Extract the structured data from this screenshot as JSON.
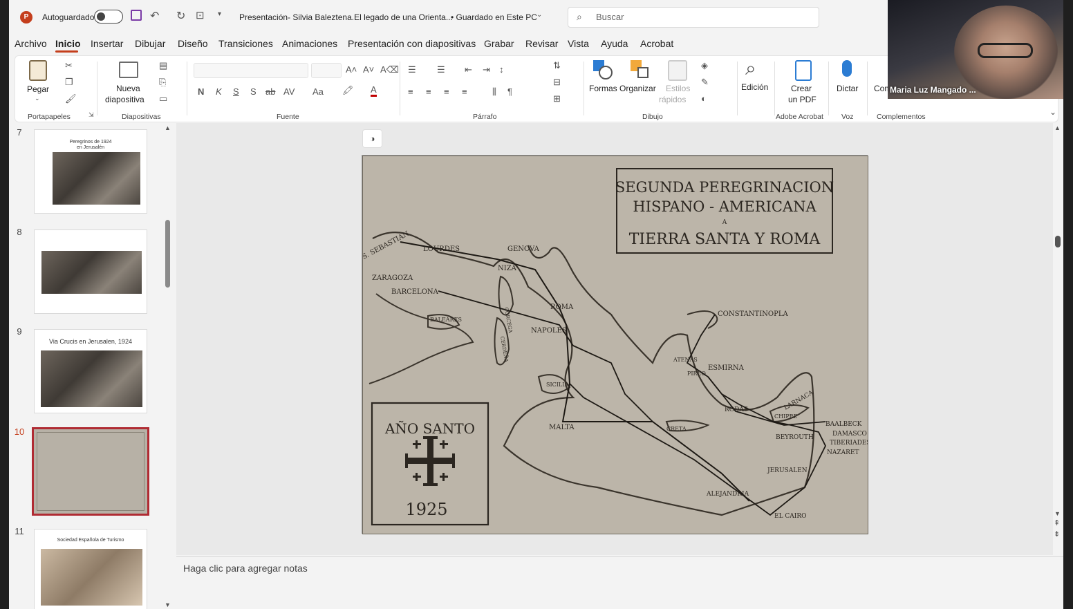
{
  "titlebar": {
    "autosave_label": "Autoguardado",
    "doc_title": "Presentación- Silvia Baleztena.El legado de una Orienta...",
    "save_status": "• Guardado en Este PC",
    "search_placeholder": "Buscar"
  },
  "menu": [
    "Archivo",
    "Inicio",
    "Insertar",
    "Dibujar",
    "Diseño",
    "Transiciones",
    "Animaciones",
    "Presentación con diapositivas",
    "Grabar",
    "Revisar",
    "Vista",
    "Ayuda",
    "Acrobat"
  ],
  "ribbon": {
    "pegar": "Pegar",
    "nueva1": "Nueva",
    "nueva2": "diapositiva",
    "formas": "Formas",
    "organizar": "Organizar",
    "estilos1": "Estilos",
    "estilos2": "rápidos",
    "edicion": "Edición",
    "crear1": "Crear",
    "crear2": "un PDF",
    "dictar": "Dictar",
    "comp": "Comp",
    "groups": {
      "portapapeles": "Portapapeles",
      "diapositivas": "Diapositivas",
      "fuente": "Fuente",
      "parrafo": "Párrafo",
      "dibujo": "Dibujo",
      "adobe": "Adobe Acrobat",
      "voz": "Voz",
      "complementos": "Complementos"
    },
    "font_buttons": {
      "bold": "N",
      "italic": "K",
      "underline": "S",
      "shadow": "S",
      "strike": "ab",
      "spacing": "AV",
      "case": "Aa"
    }
  },
  "webcam": {
    "name": "Maria Luz Mangado ..."
  },
  "slides": [
    {
      "num": "7",
      "title": "Peregrinos de 1924 en Jerusalén"
    },
    {
      "num": "8",
      "title": ""
    },
    {
      "num": "9",
      "title": "Via Crucis en Jerusalen, 1924"
    },
    {
      "num": "10",
      "title": ""
    },
    {
      "num": "11",
      "title": "Sociedad Española de Turismo"
    }
  ],
  "map": {
    "title1": "SEGUNDA PEREGRINACION",
    "title2": "HISPANO - AMERICANA",
    "title3": "A",
    "title4": "TIERRA SANTA Y ROMA",
    "seal_text": "AÑO SANTO",
    "seal_year": "1925",
    "places": [
      "S. SEBASTIAN",
      "LOURDES",
      "GENOVA",
      "NIZA",
      "ZARAGOZA",
      "BARCELONA",
      "ROMA",
      "BALEARES",
      "NAPOLES",
      "CORCEGA",
      "CERDEÑA",
      "SICILIA",
      "MALTA",
      "CONSTANTINOPLA",
      "ATENAS",
      "PIREO",
      "ESMIRNA",
      "RODAS",
      "CRETA",
      "CHIPRE",
      "LARNACA",
      "BAALBECK",
      "DAMASCO",
      "TIBERIADES",
      "NAZARET",
      "BEYROUTH",
      "JERUSALEN",
      "ALEJANDRIA",
      "EL CAIRO"
    ]
  },
  "notes_placeholder": "Haga clic para agregar notas"
}
